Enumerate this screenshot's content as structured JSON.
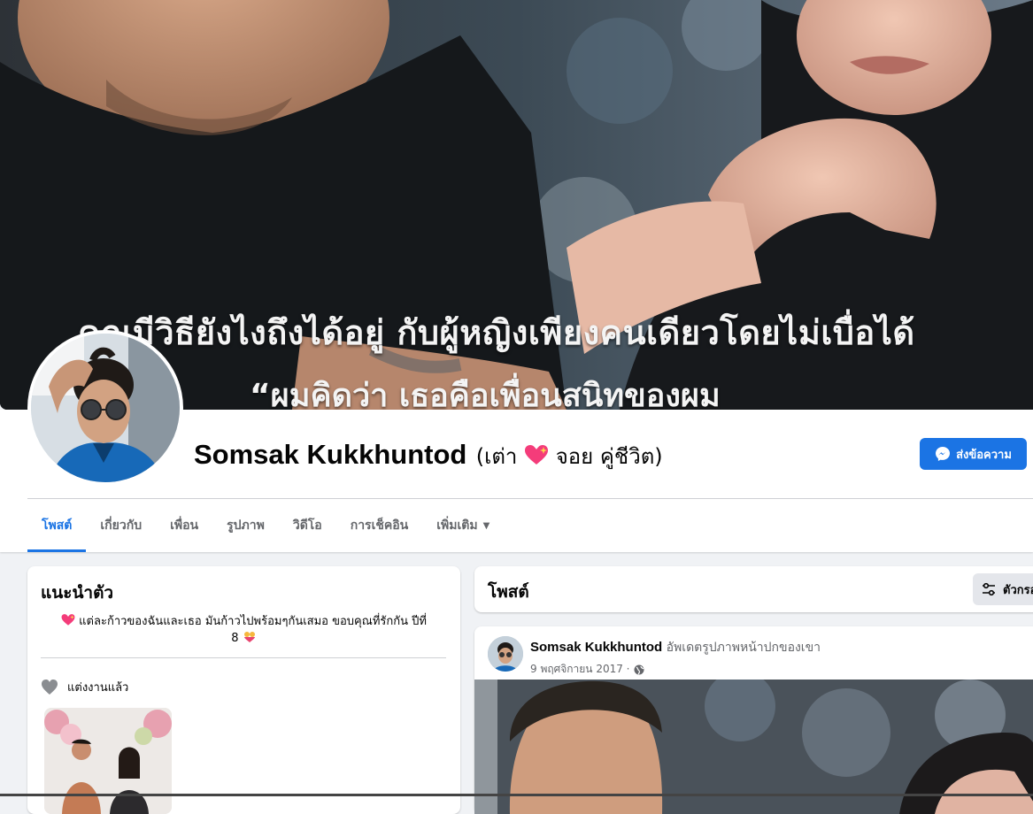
{
  "cover": {
    "caption_line1": "คุณมีวิธียังไงถึงได้อยู่ กับผู้หญิงเพียงคนเดียวโดยไม่เบื่อได้",
    "caption_line2": "“ผมคิดว่า เธอคือเพื่อนสนิทของผม"
  },
  "profile": {
    "name": "Somsak Kukkhuntod",
    "alt_name_prefix": "(เต่า",
    "alt_name_suffix": "จอย คู่ชีวิต)"
  },
  "actions": {
    "message_label": "ส่งข้อความ"
  },
  "tabs": [
    {
      "label": "โพสต์",
      "active": true
    },
    {
      "label": "เกี่ยวกับ"
    },
    {
      "label": "เพื่อน"
    },
    {
      "label": "รูปภาพ"
    },
    {
      "label": "วิดีโอ"
    },
    {
      "label": "การเช็คอิน"
    },
    {
      "label": "เพิ่มเติม"
    }
  ],
  "intro": {
    "title": "แนะนำตัว",
    "bio_line1": "แต่ละก้าวของฉันและเธอ มันก้าวไปพร้อมๆกันเสมอ ขอบคุณที่รักกัน ปีที่",
    "bio_line2": "8",
    "relationship": "แต่งงานแล้ว"
  },
  "posts": {
    "title": "โพสต์",
    "filter_label": "ตัวกรอง",
    "items": [
      {
        "author": "Somsak Kukkhuntod",
        "action": "อัพเดตรูปภาพหน้าปกของเขา",
        "date": "9 พฤศจิกายน 2017 ·"
      }
    ]
  },
  "colors": {
    "accent": "#1b74e4",
    "page_bg": "#f0f2f5",
    "muted_text": "#65676b"
  }
}
